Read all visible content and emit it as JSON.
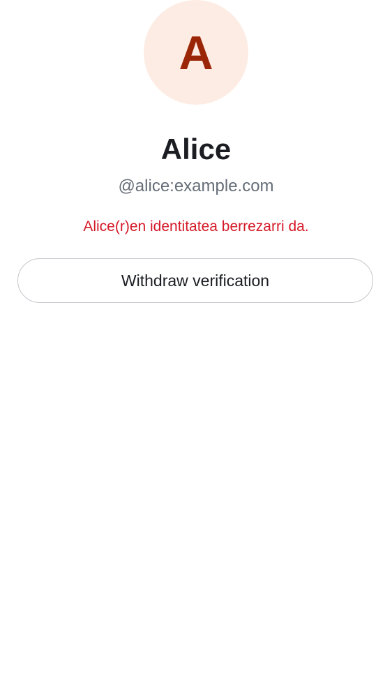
{
  "profile": {
    "avatar_initial": "A",
    "display_name": "Alice",
    "user_id": "@alice:example.com",
    "verification_warning": "Alice(r)en identitatea berrezarri da."
  },
  "actions": {
    "withdraw_label": "Withdraw verification"
  },
  "colors": {
    "avatar_background": "#fdece3",
    "avatar_letter": "#9a2607",
    "warning_text": "#d51928",
    "secondary_text": "#656d77",
    "primary_text": "#1b1d22",
    "button_border": "#c4c7cc"
  }
}
